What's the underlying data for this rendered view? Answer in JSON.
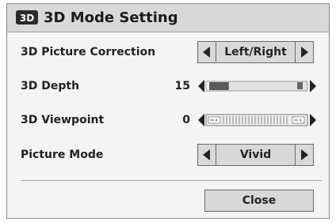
{
  "dialog": {
    "icon": "3d-icon",
    "icon_text": "3D",
    "title": "3D Mode Setting"
  },
  "rows": {
    "picture_correction": {
      "label": "3D Picture Correction",
      "value": "Left/Right"
    },
    "depth": {
      "label": "3D Depth",
      "value": "15",
      "level_fraction": 0.15
    },
    "viewpoint": {
      "label": "3D Viewpoint",
      "value": "0",
      "level_fraction": 0.5
    },
    "picture_mode": {
      "label": "Picture Mode",
      "value": "Vivid"
    }
  },
  "close_label": "Close",
  "colors": {
    "panel": "#f4f4f4",
    "header": "#d9d9d9",
    "control": "#d9d9d9",
    "border": "#6a6a6a",
    "text": "#222222"
  }
}
